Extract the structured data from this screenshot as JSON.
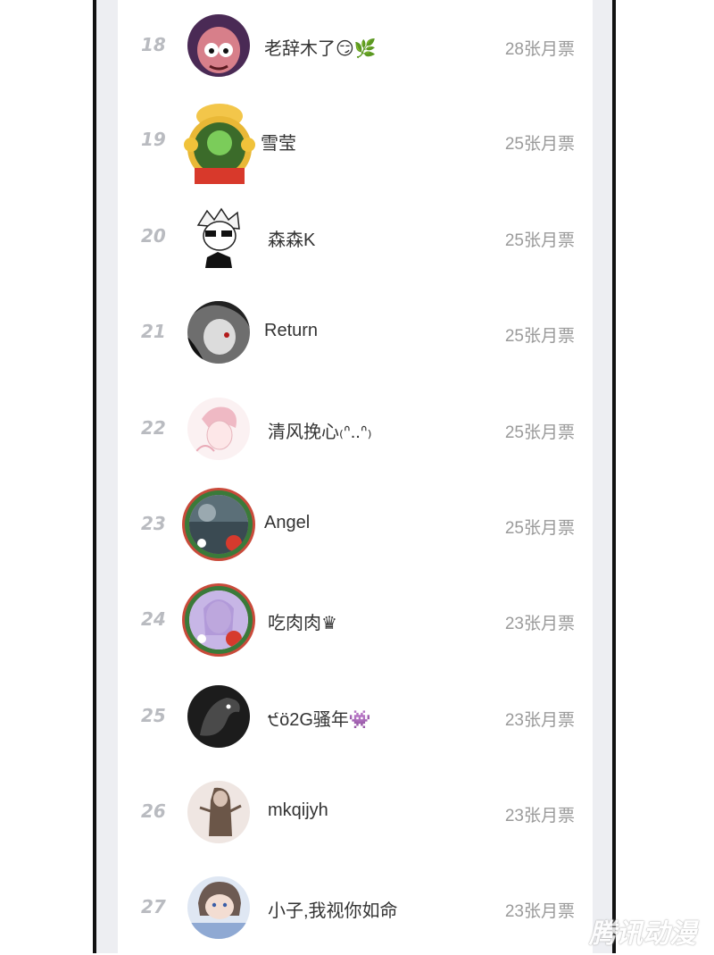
{
  "ranking": {
    "rows": [
      {
        "rank": "18",
        "name": "老辞木了😏🌿",
        "votes": "28张月票",
        "avatar": "avatar-purple-character"
      },
      {
        "rank": "19",
        "name": "雪莹",
        "votes": "25张月票",
        "avatar": "avatar-2021-ox-frame"
      },
      {
        "rank": "20",
        "name": "森森K",
        "votes": "25张月票",
        "avatar": "avatar-sunglasses-sketch"
      },
      {
        "rank": "21",
        "name": "Return",
        "votes": "25张月票",
        "avatar": "avatar-grayscale-anime"
      },
      {
        "rank": "22",
        "name": "清风挽心₍ᐢ..ᐢ₎",
        "votes": "25张月票",
        "avatar": "avatar-pink-sketch"
      },
      {
        "rank": "23",
        "name": "Angel",
        "votes": "25张月票",
        "avatar": "avatar-strawberry-frame"
      },
      {
        "rank": "24",
        "name": "吃肉肉♛",
        "votes": "23张月票",
        "avatar": "avatar-strawberry-frame-purple"
      },
      {
        "rank": "25",
        "name": "੯ö2G骚年👾",
        "votes": "23张月票",
        "avatar": "avatar-dark-wolf"
      },
      {
        "rank": "26",
        "name": "mkqijyh",
        "votes": "23张月票",
        "avatar": "avatar-anime-figure"
      },
      {
        "rank": "27",
        "name": "小子,我视你如命",
        "votes": "23张月票",
        "avatar": "avatar-girl-blue"
      }
    ]
  },
  "watermark": "腾讯动漫",
  "colors": {
    "rank": "#b9bbc0",
    "votes": "#9a9a9a",
    "name": "#333333",
    "side_panel": "#edeef2"
  }
}
